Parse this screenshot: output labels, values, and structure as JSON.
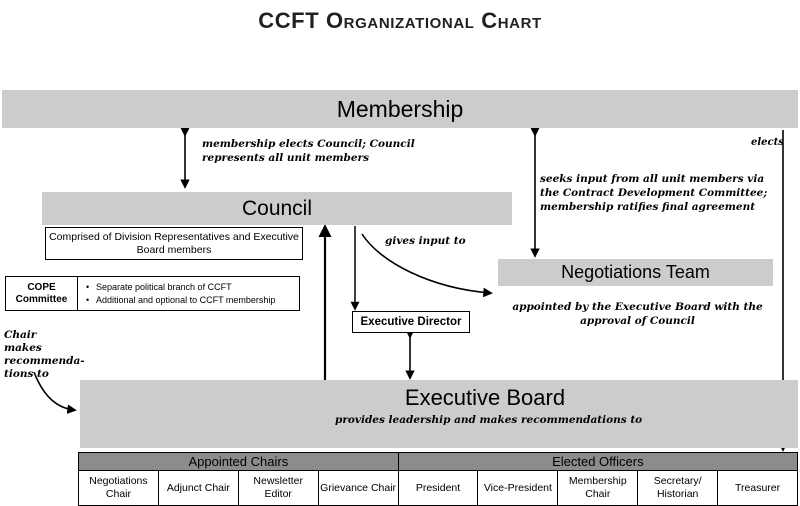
{
  "title": "CCFT Organizational Chart",
  "nodes": {
    "membership": {
      "label": "Membership"
    },
    "council": {
      "label": "Council",
      "description": "Comprised of Division Representatives and Executive Board members"
    },
    "cope": {
      "label_line1": "COPE",
      "label_line2": "Committee",
      "bullets": [
        "Separate political branch of CCFT",
        "Additional and optional to CCFT membership"
      ]
    },
    "negotiations_team": {
      "label": "Negotiations Team",
      "note": "appointed by the Executive Board with the approval of Council"
    },
    "executive_director": {
      "label": "Executive Director"
    },
    "executive_board": {
      "label": "Executive Board",
      "note": "provides leadership and makes recommendations to"
    }
  },
  "annotations": {
    "membership_elects_council": "membership elects Council; Council represents all unit members",
    "seeks_input": "seeks input from all unit members via the Contract Development Committee; membership ratifies final agreement",
    "gives_input_to": "gives input to",
    "chair_makes_recommendations": "Chair makes recommenda-tions to",
    "elects": "elects"
  },
  "bottom_table": {
    "groups": [
      {
        "label": "Appointed Chairs",
        "span": 4
      },
      {
        "label": "Elected Officers",
        "span": 5
      }
    ],
    "cells": [
      "Negotiations Chair",
      "Adjunct Chair",
      "Newsletter Editor",
      "Grievance Chair",
      "President",
      "Vice-President",
      "Membership Chair",
      "Secretary/ Historian",
      "Treasurer"
    ]
  },
  "colors": {
    "band_light": "#cccccc",
    "band_dark": "#8c8c8c",
    "text": "#000000",
    "title": "#231f20"
  }
}
